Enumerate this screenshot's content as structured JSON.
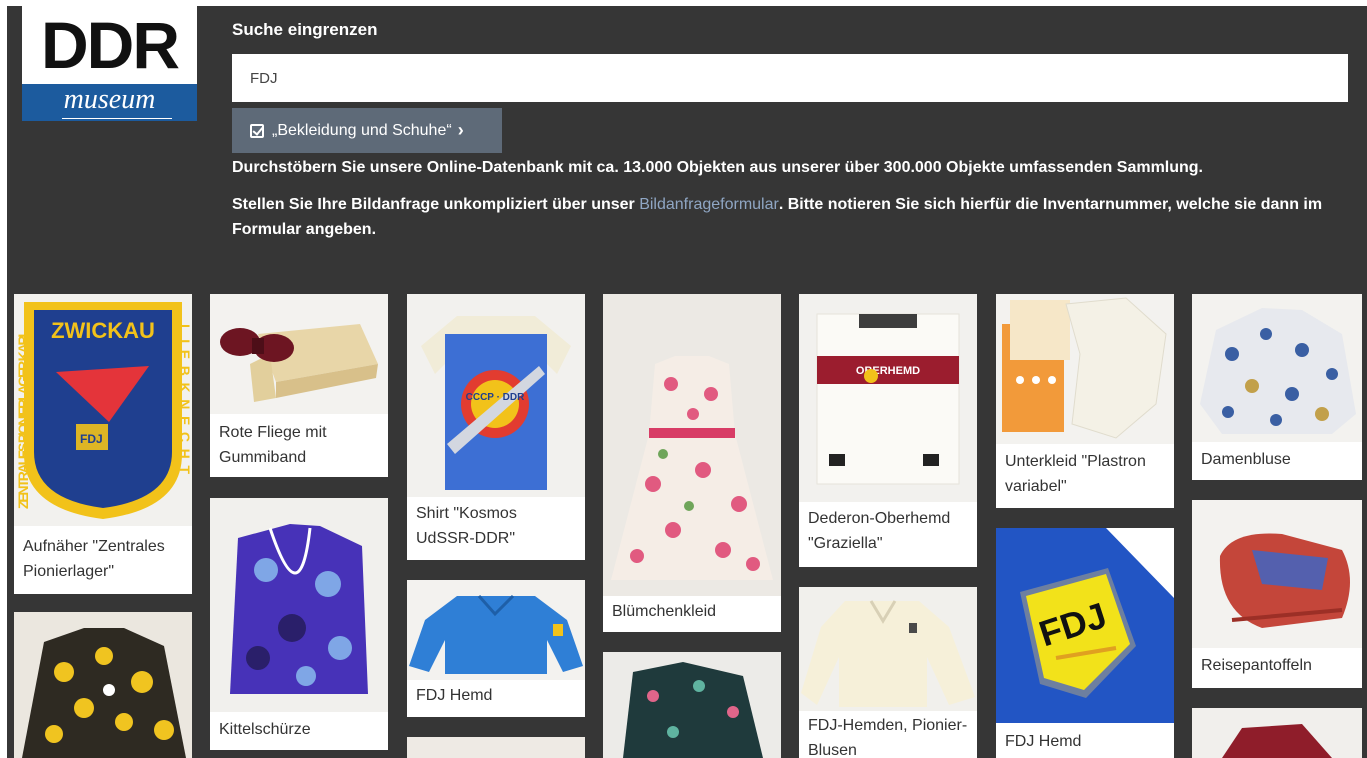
{
  "logo": {
    "top": "DDR",
    "bottom": "museum"
  },
  "header": {
    "title": "Suche eingrenzen",
    "search_value": "FDJ",
    "filter_label": "„Bekleidung und Schuhe“",
    "info_line1": "Durchstöbern Sie unsere Online-Datenbank mit ca. 13.000 Objekten aus unserer über 300.000 Objekte umfassenden Sammlung.",
    "info_line2_pre": "Stellen Sie Ihre Bildanfrage unkompliziert über unser ",
    "info_line2_link": "Bildanfrageformular",
    "info_line2_post": ". Bitte notieren Sie sich hierfür die Inventarnummer, welche sie dann im Formular angeben."
  },
  "items": [
    {
      "caption": "Aufnäher \"Zentrales Pionierlager\""
    },
    {
      "caption": "Rote Fliege mit Gummiband"
    },
    {
      "caption": "Kittelschürze"
    },
    {
      "caption": "Shirt \"Kosmos UdSSR-DDR\""
    },
    {
      "caption": "FDJ Hemd"
    },
    {
      "caption": "Blümchenkleid"
    },
    {
      "caption": "Dederon-Oberhemd \"Graziella\""
    },
    {
      "caption": "FDJ-Hemden, Pionier-Blusen"
    },
    {
      "caption": "Unterkleid \"Plastron variabel\""
    },
    {
      "caption": "FDJ Hemd"
    },
    {
      "caption": "Damenbluse"
    },
    {
      "caption": "Reisepantoffeln"
    }
  ],
  "image_texts": {
    "patch_top": "ZWICKAU",
    "patch_left": "ZENTRALES PIONIERLAGER KARL",
    "patch_right": "LIEBKNECHT",
    "patch_badge": "FDJ",
    "shirt_text": "CCCP · DDR",
    "box_label": "OBERHEMD",
    "fdj_patch": "FDJ"
  },
  "colors": {
    "background": "#363636",
    "logo_blue": "#1c5b9e",
    "filter_button": "#5e6a78",
    "link": "#8fa6c4"
  }
}
